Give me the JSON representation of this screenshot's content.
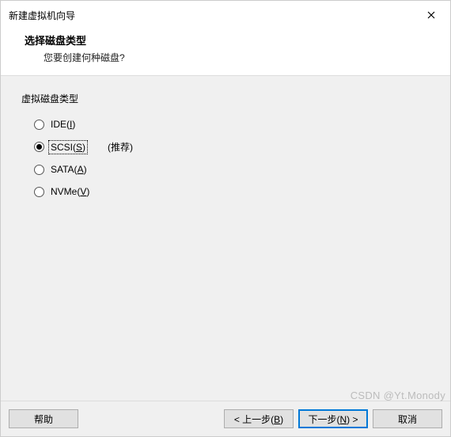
{
  "window": {
    "title": "新建虚拟机向导"
  },
  "header": {
    "title": "选择磁盘类型",
    "subtitle": "您要创建何种磁盘?"
  },
  "group": {
    "label": "虚拟磁盘类型",
    "recommend": "(推荐)",
    "options": [
      {
        "text": "IDE",
        "key": "I",
        "selected": false
      },
      {
        "text": "SCSI",
        "key": "S",
        "selected": true,
        "recommended": true
      },
      {
        "text": "SATA",
        "key": "A",
        "selected": false
      },
      {
        "text": "NVMe",
        "key": "V",
        "selected": false
      }
    ]
  },
  "footer": {
    "help": "帮助",
    "back_prefix": "< 上一步(",
    "back_key": "B",
    "back_suffix": ")",
    "next_prefix": "下一步(",
    "next_key": "N",
    "next_suffix": ") >",
    "cancel": "取消"
  },
  "watermark": "CSDN @Yt.Monody"
}
